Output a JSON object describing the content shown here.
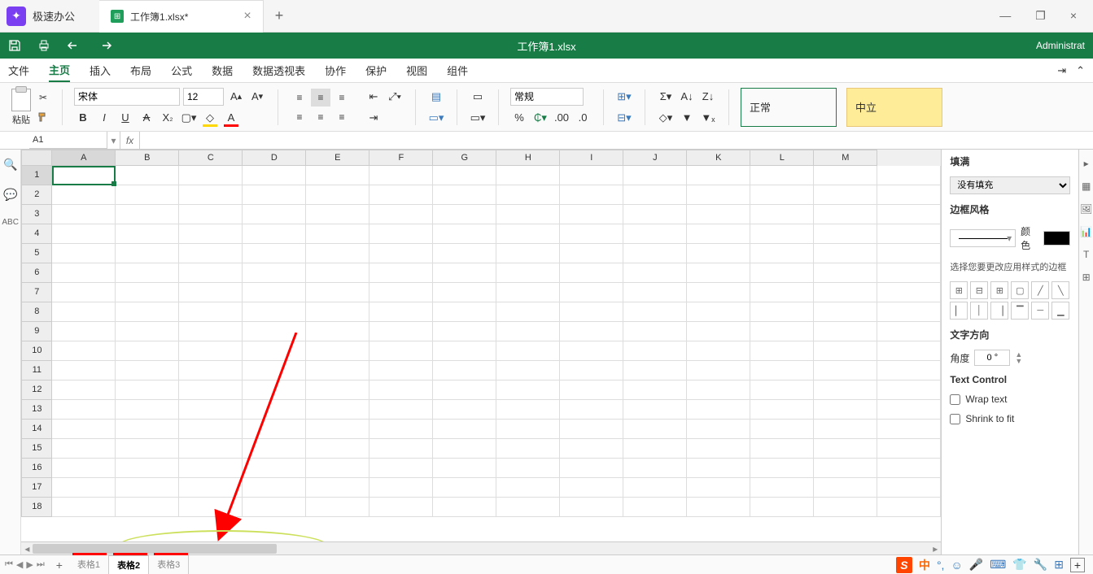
{
  "app": {
    "name": "极速办公"
  },
  "filetab": {
    "name": "工作簿1.xlsx*",
    "close": "×"
  },
  "window": {
    "min": "—",
    "max": "❐",
    "close": "×"
  },
  "greenbar": {
    "title": "工作簿1.xlsx",
    "admin": "Administrat"
  },
  "menu": {
    "file": "文件",
    "home": "主页",
    "insert": "插入",
    "layout": "布局",
    "formula": "公式",
    "data": "数据",
    "pivot": "数据透视表",
    "collab": "协作",
    "protect": "保护",
    "view": "视图",
    "component": "组件"
  },
  "ribbon": {
    "paste": "粘贴",
    "font": "宋体",
    "size": "12",
    "bold": "B",
    "italic": "I",
    "underline": "U",
    "strike": "A",
    "number_format": "常规",
    "style_normal": "正常",
    "style_neutral": "中立"
  },
  "namebox": "A1",
  "columns": [
    "A",
    "B",
    "C",
    "D",
    "E",
    "F",
    "G",
    "H",
    "I",
    "J",
    "K",
    "L",
    "M"
  ],
  "rows": [
    "1",
    "2",
    "3",
    "4",
    "5",
    "6",
    "7",
    "8",
    "9",
    "10",
    "11",
    "12",
    "13",
    "14",
    "15",
    "16",
    "17",
    "18"
  ],
  "rightpanel": {
    "fill": "填满",
    "nofill": "没有填充",
    "borderstyle": "边框风格",
    "color": "颜色",
    "border_desc": "选择您要更改应用样式的边框",
    "textdir": "文字方向",
    "angle": "角度",
    "angle_val": "0 °",
    "textcontrol": "Text Control",
    "wrap": "Wrap text",
    "shrink": "Shrink to fit"
  },
  "sheets": {
    "s1": "表格1",
    "s2": "表格2",
    "s3": "表格3"
  },
  "ime": {
    "cn": "中"
  }
}
